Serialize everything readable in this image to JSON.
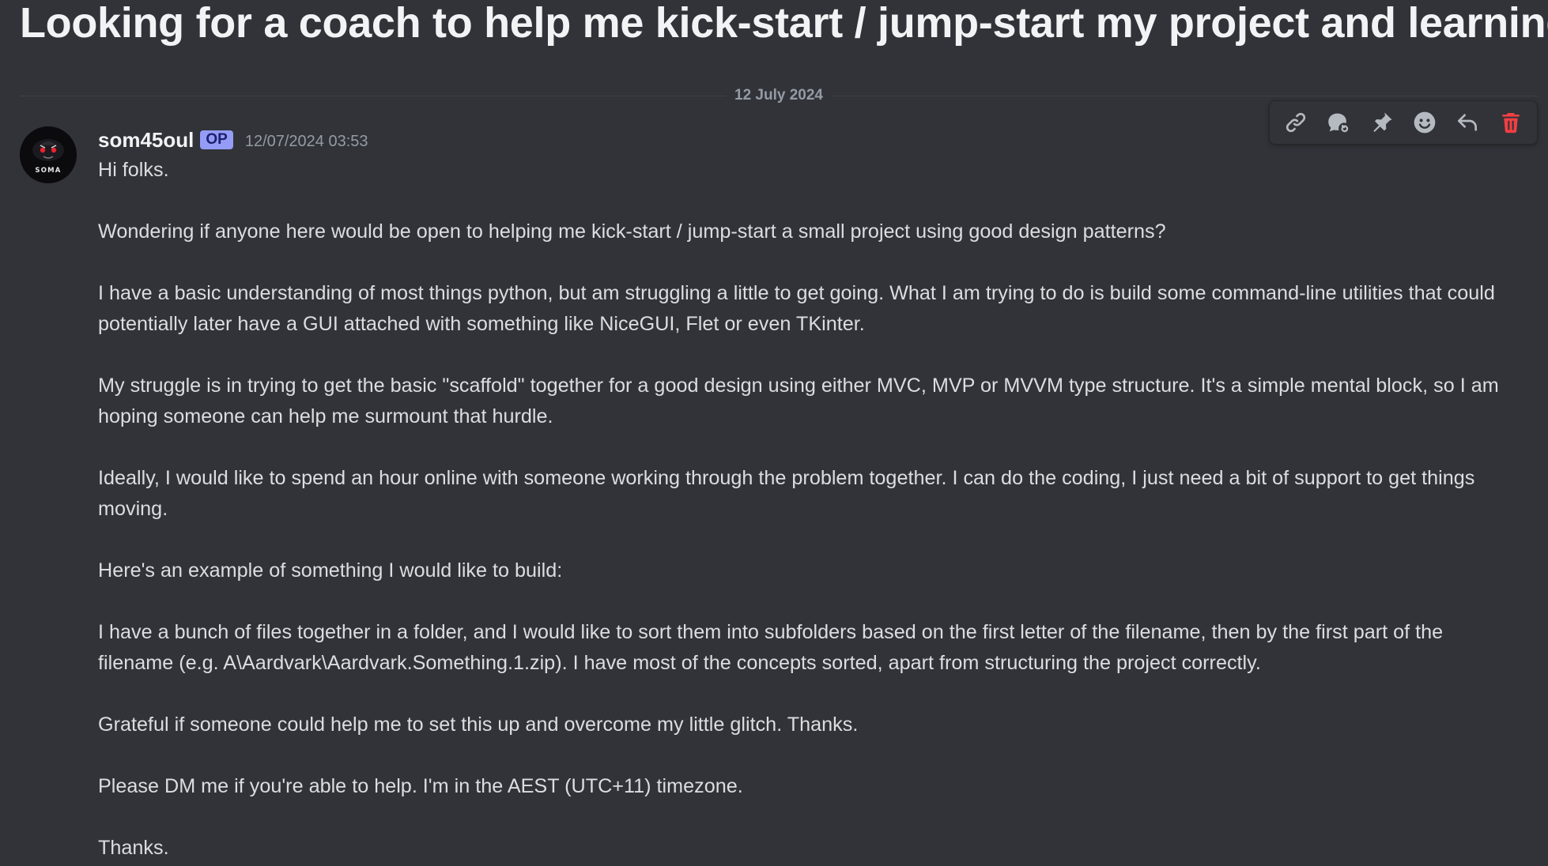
{
  "thread": {
    "title": "Looking for a coach to help me kick-start / jump-start my project and learning"
  },
  "date_divider": {
    "label": "12 July 2024"
  },
  "message": {
    "author": "som45oul",
    "badge": "OP",
    "timestamp": "12/07/2024 03:53",
    "avatar_text": "SOMA",
    "paragraphs": [
      "Hi folks.",
      "Wondering if anyone here would be open to helping me kick-start / jump-start a small project using good design patterns?",
      "I have a basic understanding of most things python, but am struggling a little to get going.  What I am trying to do is build some command-line utilities that could potentially later have a GUI attached with something like NiceGUI, Flet or even TKinter.",
      "My struggle is in trying to get the basic \"scaffold\" together for a good design using either MVC, MVP or MVVM type structure.  It's a simple mental block, so I am hoping someone can help me surmount that hurdle.",
      "Ideally, I would like to spend an hour online with someone working through the problem together. I can do the coding, I just need a bit of support to get things moving.",
      "Here's an example of something I would like to build:",
      "I have a bunch of files together in a folder, and I would like to sort them into subfolders based on the first letter of the filename, then by the first part of the filename (e.g. A\\Aardvark\\Aardvark.Something.1.zip).  I have most of the concepts sorted, apart from structuring the project correctly.",
      "Grateful if someone could help me to set this up and overcome my little glitch. Thanks.",
      "Please DM me if you're able to help.  I'm in the AEST (UTC+11) timezone.",
      "Thanks."
    ]
  },
  "toolbar": {
    "icons": [
      "link-icon",
      "thread-reply-icon",
      "pin-icon",
      "emoji-icon",
      "reply-icon",
      "delete-icon"
    ]
  },
  "colors": {
    "background": "#313338",
    "op_badge": "#949cf7",
    "delete": "#f23f43",
    "muted_text": "#949ba4"
  }
}
